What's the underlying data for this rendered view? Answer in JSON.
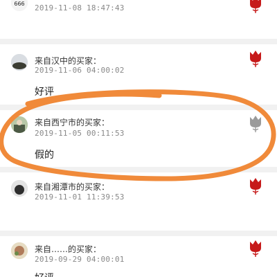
{
  "reviews": [
    {
      "name": "",
      "time": "2019-11-08 18:47:43",
      "body": "",
      "flower_color": "#c61a1a"
    },
    {
      "name": "来自汉中的买家：",
      "time": "2019-11-06 04:00:02",
      "body": "好评",
      "flower_color": "#c61a1a"
    },
    {
      "name": "来自西宁市的买家：",
      "time": "2019-11-05 00:11:53",
      "body": "假的",
      "flower_color": "#9a9a9a"
    },
    {
      "name": "来自湘潭市的买家：",
      "time": "2019-11-01 11:39:53",
      "body": "",
      "flower_color": "#c61a1a"
    },
    {
      "name": "来自……的买家：",
      "time": "2019-09-29 04:00:01",
      "body": "好评",
      "flower_color": "#c61a1a"
    }
  ],
  "annotation": {
    "color": "#f08a3a"
  }
}
